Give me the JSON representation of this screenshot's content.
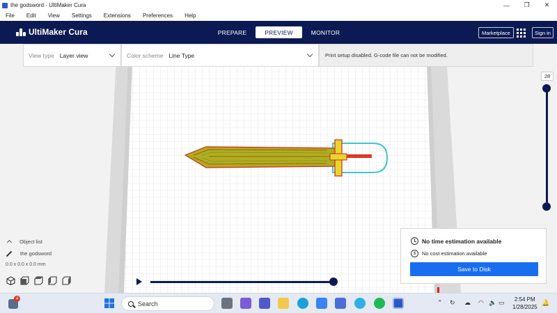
{
  "window": {
    "title": "the godsword - UltiMaker Cura",
    "controls": [
      "minimize-icon",
      "restore-icon",
      "close-icon"
    ]
  },
  "menu": [
    "File",
    "Edit",
    "View",
    "Settings",
    "Extensions",
    "Preferences",
    "Help"
  ],
  "header": {
    "brand": "UltiMaker Cura",
    "stages": [
      {
        "label": "PREPARE",
        "active": false
      },
      {
        "label": "PREVIEW",
        "active": true
      },
      {
        "label": "MONITOR",
        "active": false
      }
    ],
    "marketplace": "Marketplace",
    "signin": "Sign in"
  },
  "toolbar": {
    "view_type_label": "View type",
    "view_type_value": "Layer view",
    "color_scheme_label": "Color scheme",
    "color_scheme_value": "Line Type",
    "message": "Print setup disabled. G-code file can not be modified."
  },
  "layer_slider": {
    "current_layer": "28",
    "upper_fraction": 1.0,
    "lower_fraction": 0.0
  },
  "object_list": {
    "title": "Object list",
    "object_name": "the godsword",
    "dimensions": "0.0 x 0.0 x 0.0 mm"
  },
  "simulation": {
    "progress": 1.0
  },
  "estimate": {
    "time": "No time estimation available",
    "cost": "No cost estimation available",
    "save_button": "Save to Disk"
  },
  "colors": {
    "header": "#0c1a53",
    "accent_button": "#196ef0",
    "infill_green": "#9aa21b",
    "wall_red": "#d5271d",
    "skirt_cyan": "#3ac7d0",
    "support_yellow": "#e8d630"
  },
  "taskbar": {
    "search_placeholder": "Search",
    "notification_count": "4",
    "time": "2:54 PM",
    "date": "1/28/2025"
  }
}
